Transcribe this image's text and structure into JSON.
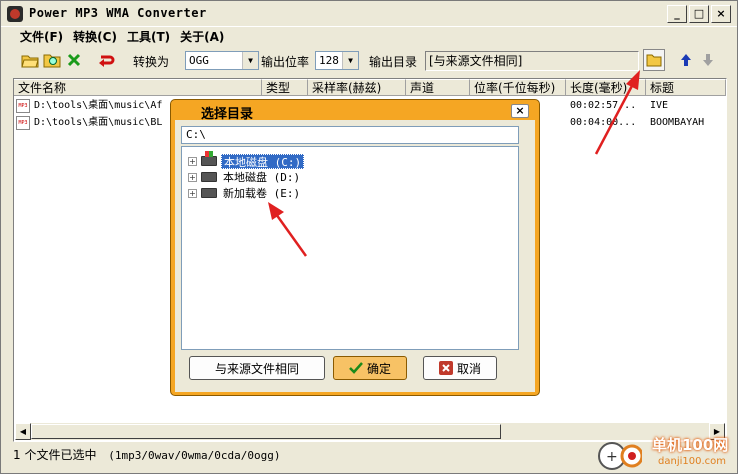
{
  "window": {
    "title": "Power MP3 WMA Converter"
  },
  "titlebar_buttons": {
    "minimize": "_",
    "maximize": "□",
    "close": "×"
  },
  "menu": [
    "文件(F)",
    "转换(C)",
    "工具(T)",
    "关于(A)"
  ],
  "toolbar": {
    "convert_to_label": "转换为",
    "format_value": "OGG",
    "bitrate_label": "输出位率",
    "bitrate_value": "128",
    "output_dir_label": "输出目录",
    "output_dir_value": "[与来源文件相同]"
  },
  "table": {
    "columns": [
      "文件名称",
      "类型",
      "采样率(赫兹)",
      "声道",
      "位率(千位每秒)",
      "长度(毫秒)",
      "标题"
    ],
    "rows": [
      {
        "name": "D:\\tools\\桌面\\music\\Af",
        "length": "00:02:57...",
        "title": "IVE"
      },
      {
        "name": "D:\\tools\\桌面\\music\\BL",
        "length": "00:04:00...",
        "title": "BOOMBAYAH"
      }
    ]
  },
  "status": {
    "selected": "1 个文件已选中",
    "formats": "(1mp3/0wav/0wma/0cda/0ogg)"
  },
  "dialog": {
    "title": "选择目录",
    "path": "C:\\",
    "tree": [
      {
        "label": "本地磁盘 (C:)",
        "selected": true
      },
      {
        "label": "本地磁盘 (D:)",
        "selected": false
      },
      {
        "label": "新加载卷 (E:)",
        "selected": false
      }
    ],
    "same_as_source": "与来源文件相同",
    "ok": "确定",
    "cancel": "取消"
  },
  "watermark": {
    "text": "单机100网",
    "sub": "danji100.com"
  },
  "colors": {
    "dialog_border": "#F5A623",
    "selection": "#316AC5",
    "arrow": "#E02020"
  }
}
